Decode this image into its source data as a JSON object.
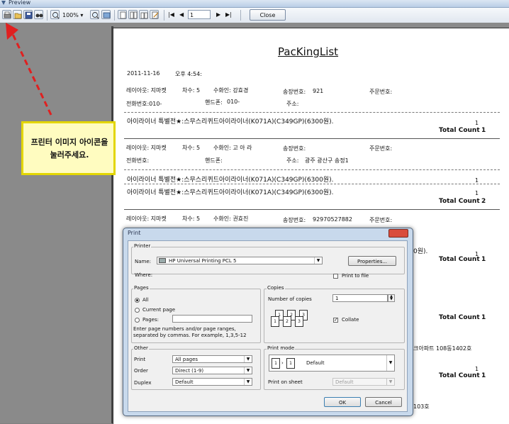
{
  "window": {
    "title": "Preview"
  },
  "toolbar": {
    "zoom": "100%",
    "page": "1",
    "close_label": "Close"
  },
  "callout": {
    "text": "프린터 이미지 아이콘을 눌러주세요."
  },
  "report": {
    "title": "PacKingList",
    "date": "2011-11-16",
    "time": "오후 4:54:",
    "blocks": [
      {
        "layout": "레이아웃: 지마켓",
        "seq": "차수:  5",
        "recv": "수화인: 강효경",
        "invoice": "송장번호:",
        "invoice_no": "921",
        "order": "주문번호:",
        "phone": "전화번호:010-",
        "mobile": "핸드폰:",
        "mobile_no": "010-",
        "addr": "주소:",
        "addr_val": "",
        "items": [
          "아이라이너 특별전★:스무스리퀴드아이라이너(K071A)(C349GP)(6300원)."
        ],
        "qtys": [
          "1"
        ],
        "total_label": "Total Count",
        "total": "1"
      },
      {
        "layout": "레이아웃: 지마켓",
        "seq": "차수:  5",
        "recv": "수화인: 고 아 라",
        "invoice": "송장번호:",
        "invoice_no": "",
        "order": "주문번호:",
        "phone": "전화번호:",
        "mobile": "핸드폰:",
        "mobile_no": "",
        "addr": "주소:",
        "addr_val": "광주 광산구 송정1",
        "items": [
          "아이라이너 특별전★:스무스리퀴드아이라이너(K071A)(C349GP)(6300원).",
          "아이라이너 특별전★:스무스리퀴드아이라이너(K071A)(C349GP)(6300원)."
        ],
        "qtys": [
          "1",
          "1"
        ],
        "total_label": "Total Count",
        "total": "2"
      },
      {
        "layout": "레이아웃: 지마켓",
        "seq": "차수:  5",
        "recv": "수화인: 권효진",
        "invoice": "송장번호:",
        "invoice_no": "92970527882",
        "order": "주문번호:"
      }
    ],
    "peek": {
      "r1": "0원).",
      "r2": "1",
      "tc1_label": "Total Count",
      "tc1": "1",
      "tc2_label": "Total Count",
      "tc2": "1",
      "tc3_label": "Total Count",
      "tc3": "1",
      "q3": "1",
      "addr3": "크아파트 108동1402호",
      "addr4": "  103호"
    }
  },
  "dialog": {
    "title": "Print",
    "printer_group": "Printer",
    "name_label": "Name:",
    "printer_name": "HP Universal Printing PCL 5",
    "properties_label": "Properties...",
    "where_label": "Where:",
    "print_to_file_label": "Print to file",
    "pages_group": "Pages",
    "opt_all": "All",
    "opt_current": "Current page",
    "opt_pages": "Pages:",
    "pages_hint": "Enter page numbers and/or page ranges, separated by commas. For example, 1,3,5-12",
    "copies_group": "Copies",
    "num_copies_label": "Number of copies",
    "num_copies": "1",
    "collate_label": "Collate",
    "other_group": "Other",
    "print_label": "Print",
    "print_val": "All pages",
    "order_label": "Order",
    "order_val": "Direct (1-9)",
    "duplex_label": "Duplex",
    "duplex_val": "Default",
    "mode_group": "Print mode",
    "mode_val": "Default",
    "print_on_sheet_label": "Print on sheet",
    "sheet_val": "Default",
    "ok_label": "OK",
    "cancel_label": "Cancel"
  }
}
